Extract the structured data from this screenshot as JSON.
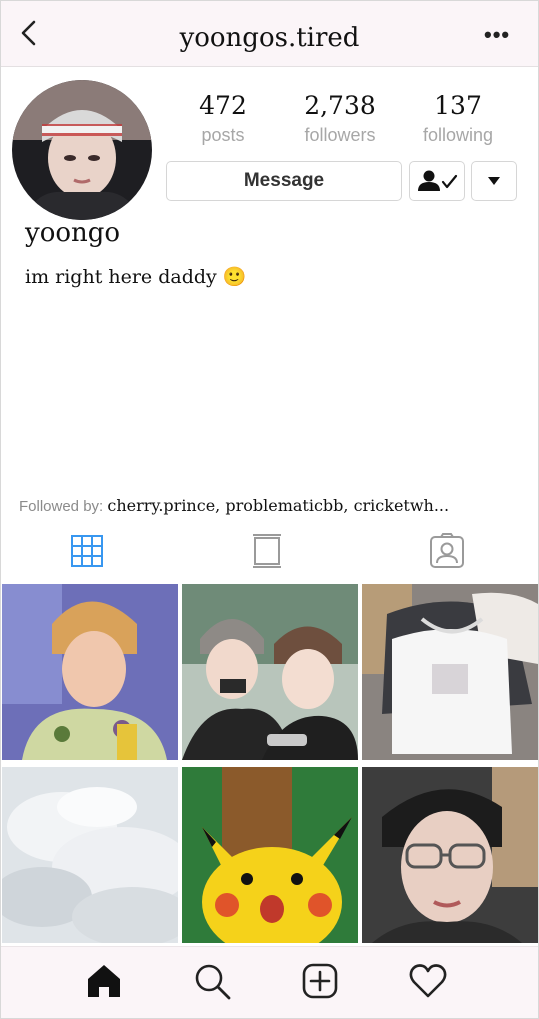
{
  "header": {
    "username": "yoongos.tired",
    "back_icon": "chevron-left-icon",
    "more_icon": "more-horizontal-icon",
    "more_label": "•••"
  },
  "profile": {
    "stats": {
      "posts": {
        "value": "472",
        "label": "posts"
      },
      "followers": {
        "value": "2,738",
        "label": "followers"
      },
      "following": {
        "value": "137",
        "label": "following"
      }
    },
    "message_label": "Message",
    "display_name": "yoongo",
    "bio": "im right here daddy",
    "bio_emoji": "🙂",
    "followed_by_label": "Followed by:",
    "followed_by_names": "cherry.prince, problematicbb, cricketwh..."
  },
  "tabs": [
    {
      "name": "grid-view-tab",
      "icon": "grid-icon",
      "active": true
    },
    {
      "name": "feed-view-tab",
      "icon": "feed-icon",
      "active": false
    },
    {
      "name": "tagged-tab",
      "icon": "tagged-icon",
      "active": false
    }
  ],
  "nav": [
    {
      "name": "home-nav",
      "icon": "home-icon"
    },
    {
      "name": "search-nav",
      "icon": "search-icon"
    },
    {
      "name": "new-post-nav",
      "icon": "add-post-icon"
    },
    {
      "name": "activity-nav",
      "icon": "heart-icon"
    }
  ],
  "colors": {
    "header_bg": "#fbf5f8",
    "accent_blue": "#3897f0",
    "muted_text": "#a7a7a7"
  }
}
